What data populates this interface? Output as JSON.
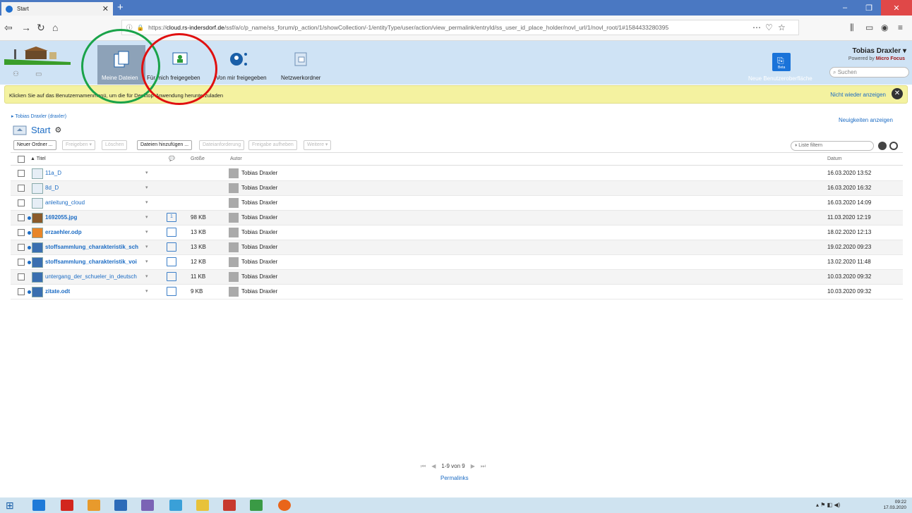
{
  "browser": {
    "tab_title": "Start",
    "url_prefix": "https://",
    "url_domain": "cloud.rs-indersdorf.de",
    "url_path": "/ssf/a/c/p_name/ss_forum/p_action/1/showCollection/-1/entityType/user/action/view_permalink/entryId/ss_user_id_place_holder/novl_url/1/novl_root/1#1584433280395"
  },
  "header": {
    "nav": [
      {
        "label": "Meine Dateien"
      },
      {
        "label": "Für mich freigegeben"
      },
      {
        "label": "Von mir freigegeben"
      },
      {
        "label": "Netzwerkordner"
      }
    ],
    "user_name": "Tobias Draxler",
    "powered_by": "Powered by",
    "powered_brand": "Micro Focus",
    "search_placeholder": "Suchen",
    "new_ui_label": "Neue Benutzeroberfläche",
    "beta": "Beta"
  },
  "notice": {
    "text": "Klicken Sie auf das Benutzernamenmenü, um die für Desktop-Anwendung herunterzuladen",
    "link": "Nicht wieder anzeigen"
  },
  "breadcrumb": "Tobias Draxler (draxler)",
  "news_link": "Neuigkeiten anzeigen",
  "page_title": "Start",
  "toolbar": {
    "new_folder": "Neuer Ordner ...",
    "share": "Freigeben ▾",
    "delete": "Löschen",
    "add_files": "Dateien hinzufügen ...",
    "file_request": "Dateianforderung",
    "unshare": "Freigabe aufheben",
    "more": "Weitere ▾",
    "filter_placeholder": "Liste filtern"
  },
  "table": {
    "headers": {
      "title": "Titel",
      "size": "Größe",
      "author": "Autor",
      "date": "Datum"
    },
    "rows": [
      {
        "name": "11a_D",
        "type": "folder",
        "new": false,
        "comments": "",
        "size": "",
        "author": "Tobias Draxler",
        "date": "16.03.2020 13:52"
      },
      {
        "name": "8d_D",
        "type": "folder",
        "new": false,
        "comments": "",
        "size": "",
        "author": "Tobias Draxler",
        "date": "16.03.2020 16:32"
      },
      {
        "name": "anleitung_cloud",
        "type": "folder",
        "new": false,
        "comments": "",
        "size": "",
        "author": "Tobias Draxler",
        "date": "16.03.2020 14:09"
      },
      {
        "name": "1692055.jpg",
        "type": "image",
        "new": true,
        "comments": "1",
        "size": "98 KB",
        "author": "Tobias Draxler",
        "date": "11.03.2020 12:19"
      },
      {
        "name": "erzaehler.odp",
        "type": "presentation",
        "new": true,
        "comments": "",
        "size": "13 KB",
        "author": "Tobias Draxler",
        "date": "18.02.2020 12:13"
      },
      {
        "name": "stoffsammlung_charakteristik_sch",
        "type": "document",
        "new": true,
        "comments": "",
        "size": "13 KB",
        "author": "Tobias Draxler",
        "date": "19.02.2020 09:23"
      },
      {
        "name": "stoffsammlung_charakteristik_voi",
        "type": "document",
        "new": true,
        "comments": "",
        "size": "12 KB",
        "author": "Tobias Draxler",
        "date": "13.02.2020 11:48"
      },
      {
        "name": "untergang_der_schueler_in_deutsch",
        "type": "document",
        "new": false,
        "comments": "",
        "size": "11 KB",
        "author": "Tobias Draxler",
        "date": "10.03.2020 09:32"
      },
      {
        "name": "zitate.odt",
        "type": "document",
        "new": true,
        "comments": "",
        "size": "9 KB",
        "author": "Tobias Draxler",
        "date": "10.03.2020 09:32"
      }
    ]
  },
  "pager": {
    "range": "1-9 von 9",
    "permalinks": "Permalinks"
  },
  "taskbar": {
    "time": "09:22",
    "date": "17.03.2020"
  },
  "colors": {
    "green_ring": "#1aa34a",
    "red_ring": "#e01010",
    "link": "#1c6cc4"
  }
}
